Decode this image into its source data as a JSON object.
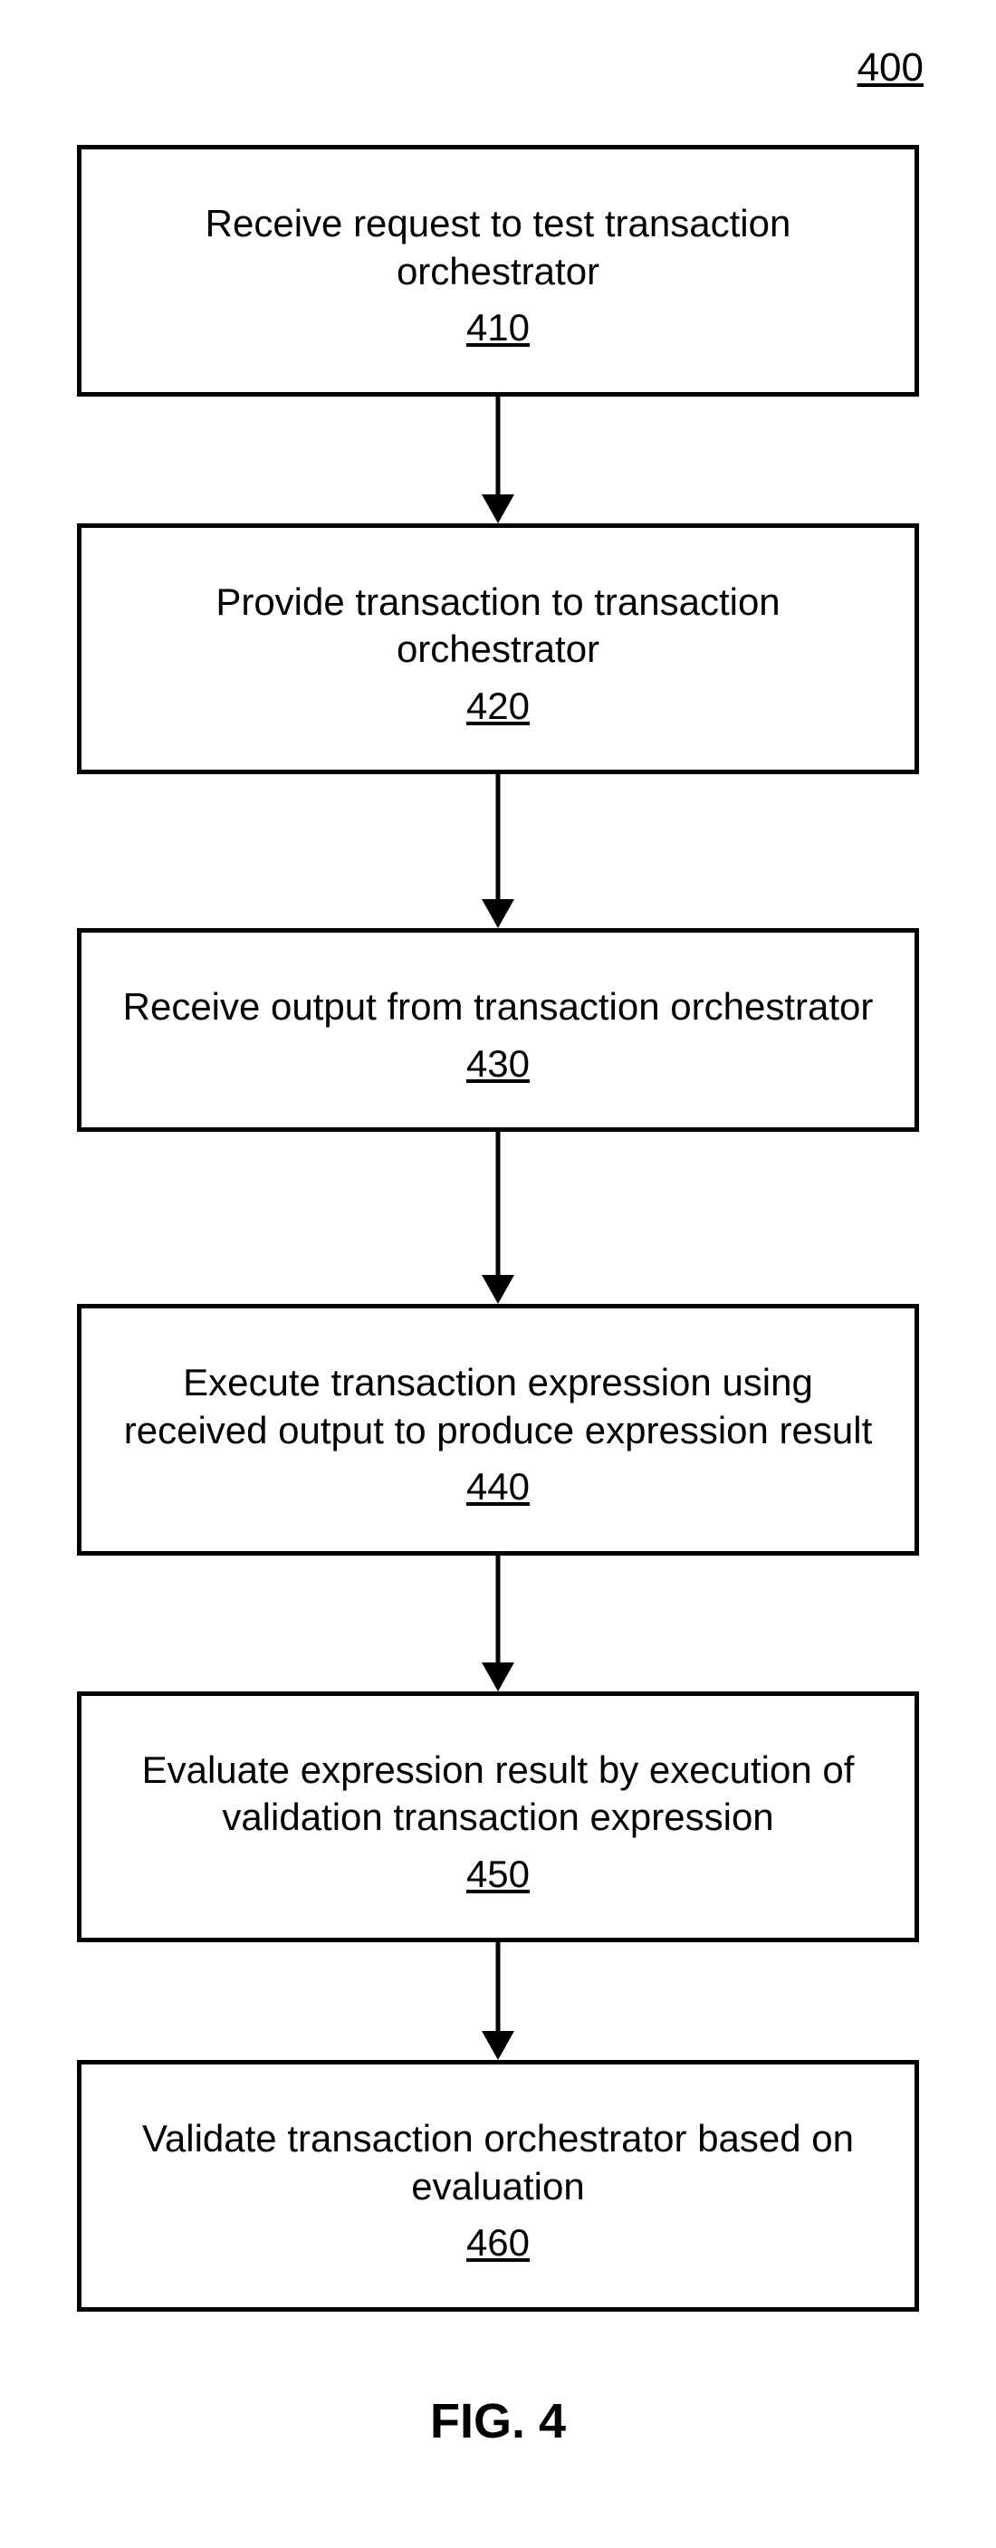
{
  "figure_id": "400",
  "caption": "FIG. 4",
  "steps": [
    {
      "label": "Receive request to test transaction orchestrator",
      "ref": "410"
    },
    {
      "label": "Provide transaction to transaction orchestrator",
      "ref": "420"
    },
    {
      "label": "Receive output from transaction orchestrator",
      "ref": "430"
    },
    {
      "label": "Execute transaction expression using received output to produce expression result",
      "ref": "440"
    },
    {
      "label": "Evaluate expression result by execution of validation transaction expression",
      "ref": "450"
    },
    {
      "label": "Validate transaction orchestrator based on evaluation",
      "ref": "460"
    }
  ],
  "arrow_heights": [
    140,
    170,
    190,
    150,
    130
  ]
}
